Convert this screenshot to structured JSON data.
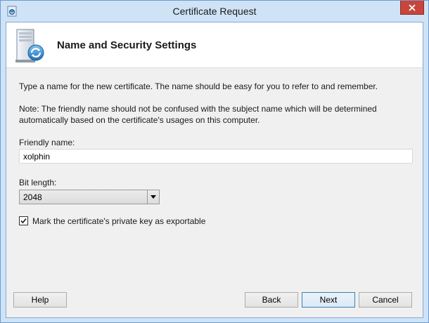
{
  "window": {
    "title": "Certificate Request"
  },
  "header": {
    "title": "Name and Security Settings"
  },
  "body": {
    "instruction": "Type a name for the new certificate. The name should be easy for you to refer to and remember.",
    "note": "Note: The friendly name should not be confused with the subject name which will be determined automatically based on the certificate's usages on this computer."
  },
  "friendly_name": {
    "label": "Friendly name:",
    "value": "xolphin"
  },
  "bit_length": {
    "label": "Bit length:",
    "selected": "2048"
  },
  "exportable": {
    "label": "Mark the certificate's private key as exportable",
    "checked": true
  },
  "buttons": {
    "help": "Help",
    "back": "Back",
    "next": "Next",
    "cancel": "Cancel"
  },
  "colors": {
    "frame": "#cfe3f7",
    "close": "#c7453b",
    "accent": "#3c7fb1"
  }
}
